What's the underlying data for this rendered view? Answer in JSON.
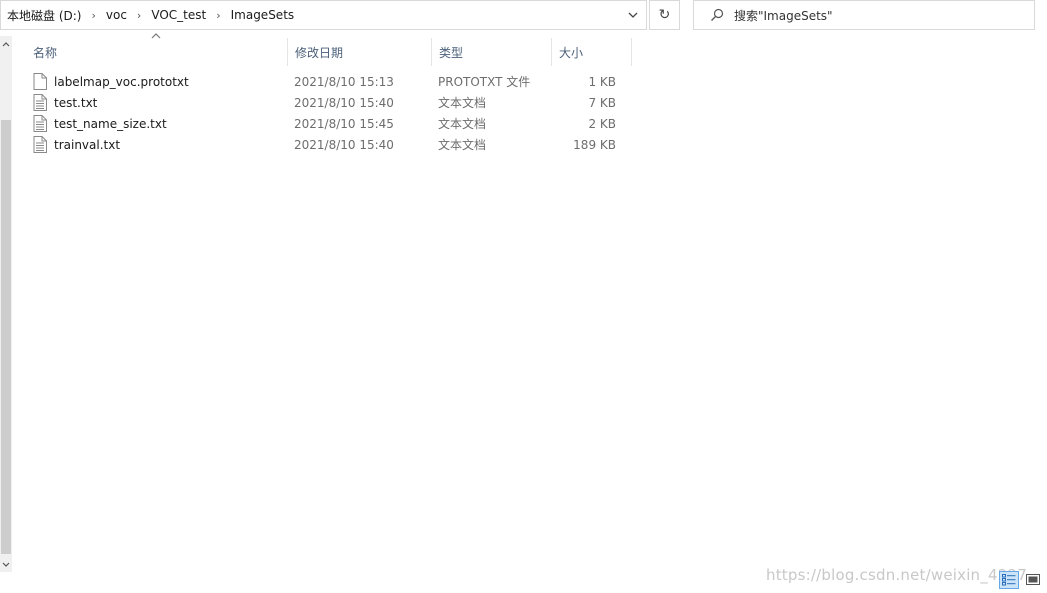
{
  "address_bar": {
    "breadcrumbs": [
      "本地磁盘 (D:)",
      "voc",
      "VOC_test",
      "ImageSets"
    ]
  },
  "search": {
    "placeholder": "搜索\"ImageSets\""
  },
  "columns": {
    "name": "名称",
    "date": "修改日期",
    "type": "类型",
    "size": "大小"
  },
  "files": [
    {
      "name": "labelmap_voc.prototxt",
      "date": "2021/8/10 15:13",
      "type": "PROTOTXT 文件",
      "size": "1 KB"
    },
    {
      "name": "test.txt",
      "date": "2021/8/10 15:40",
      "type": "文本文档",
      "size": "7 KB"
    },
    {
      "name": "test_name_size.txt",
      "date": "2021/8/10 15:45",
      "type": "文本文档",
      "size": "2 KB"
    },
    {
      "name": "trainval.txt",
      "date": "2021/8/10 15:40",
      "type": "文本文档",
      "size": "189 KB"
    }
  ],
  "watermark": "https://blog.csdn.net/weixin_4227",
  "colors": {
    "header_text": "#4c607a",
    "border": "#d9d9d9",
    "selected_view": "#cce4f7"
  },
  "icons": {
    "refresh": "refresh-icon",
    "search": "search-icon",
    "file": "file-icon"
  }
}
